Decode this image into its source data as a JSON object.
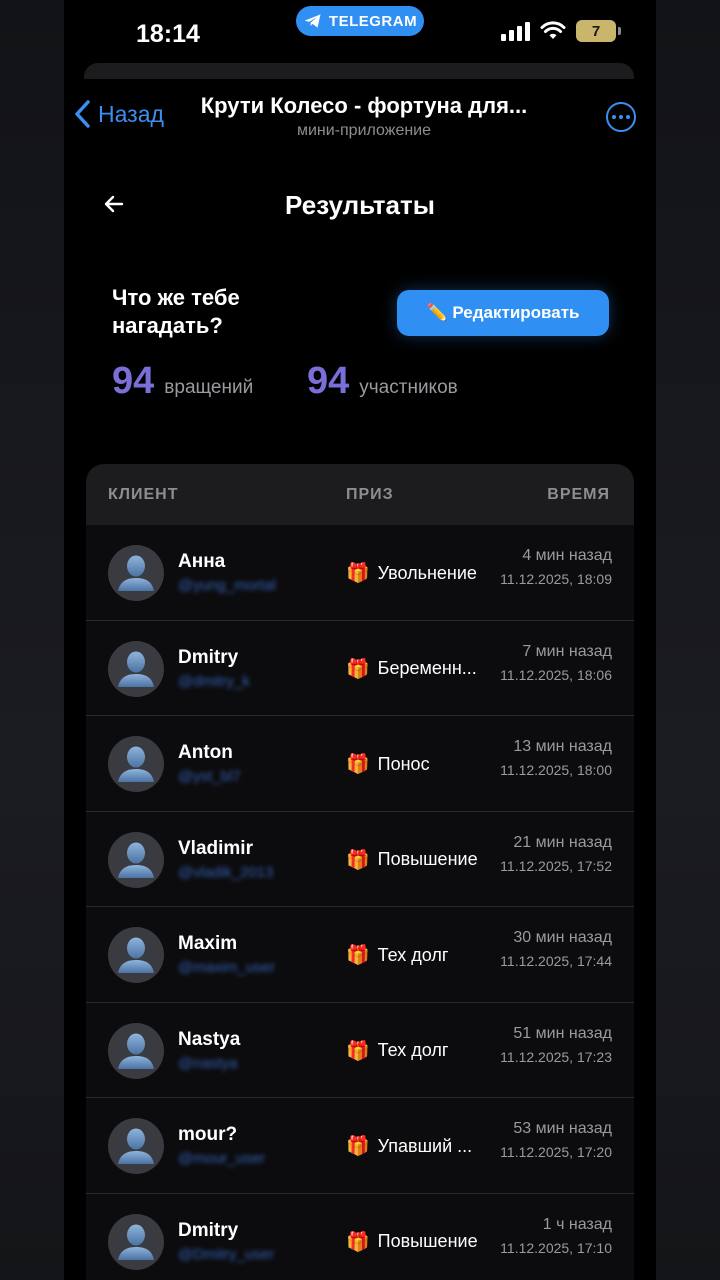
{
  "status_bar": {
    "time": "18:14",
    "source_app": "TELEGRAM",
    "battery": "7"
  },
  "nav": {
    "back_label": "Назад",
    "title": "Крути Колесо - фортуна для...",
    "subtitle": "мини-приложение"
  },
  "page": {
    "title": "Результаты",
    "question": "Что же тебе нагадать?",
    "edit_button": "✏️ Редактировать",
    "spins_count": "94",
    "spins_label": "вращений",
    "participants_count": "94",
    "participants_label": "участников"
  },
  "table": {
    "headers": {
      "client": "КЛИЕНТ",
      "prize": "ПРИЗ",
      "time": "ВРЕМЯ"
    },
    "rows": [
      {
        "name": "Анна",
        "handle": "@yung_mortal",
        "prize": "Увольнение",
        "relative": "4 мин назад",
        "datetime": "11.12.2025, 18:09"
      },
      {
        "name": "Dmitry",
        "handle": "@dmitry_k",
        "prize": "Беременн...",
        "relative": "7 мин назад",
        "datetime": "11.12.2025, 18:06"
      },
      {
        "name": "Anton",
        "handle": "@yst_bl7",
        "prize": "Понос",
        "relative": "13 мин назад",
        "datetime": "11.12.2025, 18:00"
      },
      {
        "name": "Vladimir",
        "handle": "@vladik_2013",
        "prize": "Повышение",
        "relative": "21 мин назад",
        "datetime": "11.12.2025, 17:52"
      },
      {
        "name": "Maxim",
        "handle": "@maxim_user",
        "prize": "Тех долг",
        "relative": "30 мин назад",
        "datetime": "11.12.2025, 17:44"
      },
      {
        "name": "Nastya",
        "handle": "@nastya",
        "prize": "Тех долг",
        "relative": "51 мин назад",
        "datetime": "11.12.2025, 17:23"
      },
      {
        "name": "mour?",
        "handle": "@mour_user",
        "prize": "Упавший ...",
        "relative": "53 мин назад",
        "datetime": "11.12.2025, 17:20"
      },
      {
        "name": "Dmitry",
        "handle": "@Dmitry_user",
        "prize": "Повышение",
        "relative": "1 ч назад",
        "datetime": "11.12.2025, 17:10"
      }
    ]
  },
  "colors": {
    "accent_blue": "#2f8ff3",
    "stat_purple": "#7a6fd8",
    "background": "#000000"
  }
}
